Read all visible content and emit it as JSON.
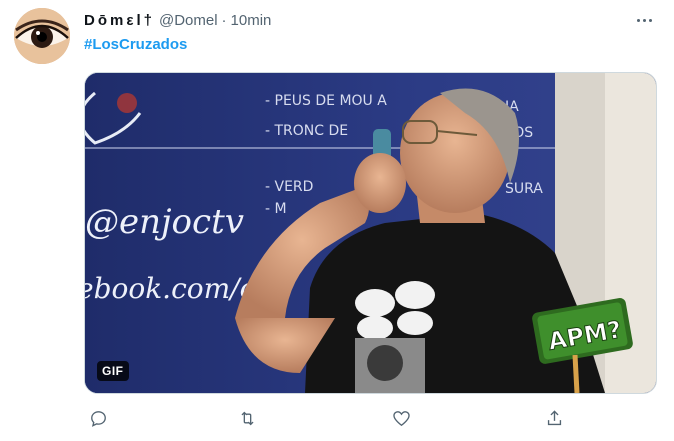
{
  "tweet": {
    "display_name": "Dōmεl†",
    "handle": "@Domel",
    "separator": "·",
    "time": "10min",
    "hashtag": "#LosCruzados",
    "media": {
      "badge": "GIF",
      "board_lines": [
        "- PEUS DE MOU A",
        "- TRONC DE",
        "- VERD",
        "- M",
        "@enjoctv",
        "ebook.com/enj"
      ],
      "board_right_lines": [
        "IA",
        "NYOS",
        "SURA"
      ],
      "speech_bubbles": [
        "",
        "",
        ""
      ],
      "sign_text": "APM?"
    },
    "actions": [
      {
        "name": "reply",
        "icon": "reply-icon"
      },
      {
        "name": "retweet",
        "icon": "retweet-icon"
      },
      {
        "name": "like",
        "icon": "heart-icon"
      },
      {
        "name": "share",
        "icon": "share-icon"
      }
    ]
  },
  "colors": {
    "link": "#1d9bf0",
    "secondary_text": "#536471",
    "board": "#28367a",
    "sign": "#3f8f2c"
  }
}
